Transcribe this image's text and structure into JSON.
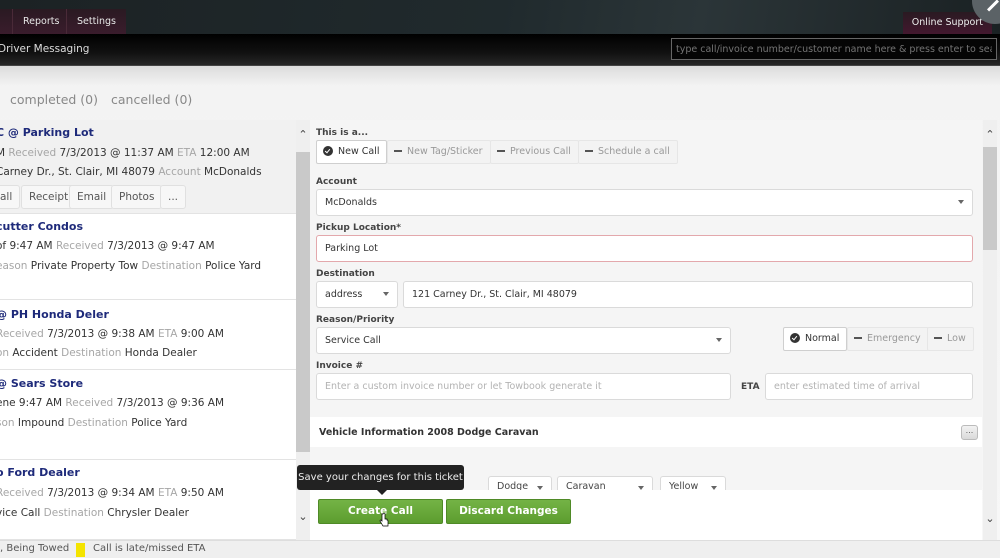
{
  "topnav": {
    "items": [
      "Reports",
      "Settings"
    ],
    "online_support": "Online Support"
  },
  "subbar": {
    "title": "Driver Messaging",
    "search_placeholder": "type call/invoice number/customer name here & press enter to search"
  },
  "status_tabs": [
    "completed (0)",
    "cancelled (0)"
  ],
  "calls": [
    {
      "title": "C @ Parking Lot",
      "line1": [
        {
          "t": "M",
          "l": false
        },
        {
          "t": "Received",
          "l": true
        },
        {
          "t": "7/3/2013 @ 11:37 AM",
          "l": false
        },
        {
          "t": "ETA",
          "l": true
        },
        {
          "t": "12:00 AM",
          "l": false
        }
      ],
      "line2": [
        {
          "t": "Carney Dr., St. Clair, MI 48079",
          "l": false
        },
        {
          "t": "Account",
          "l": true
        },
        {
          "t": "McDonalds",
          "l": false
        }
      ],
      "actions": [
        "all",
        "Receipt",
        "Email",
        "Photos",
        "..."
      ]
    },
    {
      "title": "cutter Condos",
      "line1": [
        {
          "t": "of 9:47 AM",
          "l": false
        },
        {
          "t": "Received",
          "l": true
        },
        {
          "t": "7/3/2013 @ 9:47 AM",
          "l": false
        }
      ],
      "line2": [
        {
          "t": "eason",
          "l": true
        },
        {
          "t": "Private Property Tow",
          "l": false
        },
        {
          "t": "Destination",
          "l": true
        },
        {
          "t": "Police Yard",
          "l": false
        }
      ]
    },
    {
      "title": "@ PH Honda Deler",
      "line1": [
        {
          "t": "Received",
          "l": true
        },
        {
          "t": "7/3/2013 @ 9:38 AM",
          "l": false
        },
        {
          "t": "ETA",
          "l": true
        },
        {
          "t": "9:00 AM",
          "l": false
        }
      ],
      "line2": [
        {
          "t": "on",
          "l": true
        },
        {
          "t": "Accident",
          "l": false
        },
        {
          "t": "Destination",
          "l": true
        },
        {
          "t": "Honda Dealer",
          "l": false
        }
      ]
    },
    {
      "title": "@ Sears Store",
      "line1": [
        {
          "t": "ene 9:47 AM",
          "l": false
        },
        {
          "t": "Received",
          "l": true
        },
        {
          "t": "7/3/2013 @ 9:36 AM",
          "l": false
        }
      ],
      "line2": [
        {
          "t": "son",
          "l": true
        },
        {
          "t": "Impound",
          "l": false
        },
        {
          "t": "Destination",
          "l": true
        },
        {
          "t": "Police Yard",
          "l": false
        }
      ]
    },
    {
      "title": "o Ford Dealer",
      "line1": [
        {
          "t": "Received",
          "l": true
        },
        {
          "t": "7/3/2013 @ 9:34 AM",
          "l": false
        },
        {
          "t": "ETA",
          "l": true
        },
        {
          "t": "9:50 AM",
          "l": false
        }
      ],
      "line2": [
        {
          "t": "vice Call",
          "l": false
        },
        {
          "t": "Destination",
          "l": true
        },
        {
          "t": "Chrysler Dealer",
          "l": false
        }
      ]
    }
  ],
  "form": {
    "call_type_label": "This is a...",
    "call_types": [
      "New Call",
      "New Tag/Sticker",
      "Previous Call",
      "Schedule a call"
    ],
    "selected_call_type": "New Call",
    "account_label": "Account",
    "account_value": "McDonalds",
    "pickup_label": "Pickup Location*",
    "pickup_value": "Parking Lot",
    "destination_label": "Destination",
    "destination_type": "address",
    "destination_value": "121 Carney Dr., St. Clair, MI 48079",
    "reason_label": "Reason/Priority",
    "reason_value": "Service Call",
    "priorities": [
      "Normal",
      "Emergency",
      "Low"
    ],
    "selected_priority": "Normal",
    "invoice_label": "Invoice #",
    "invoice_placeholder": "Enter a custom invoice number or let Towbook generate it",
    "eta_label": "ETA",
    "eta_placeholder": "enter estimated time of arrival",
    "vehicle_section_title": "Vehicle Information 2008 Dodge Caravan",
    "vehicle_more": "...",
    "vehicle_make": "Dodge",
    "vehicle_model": "Caravan",
    "vehicle_color": "Yellow"
  },
  "buttons": {
    "create_call": "Create Call",
    "discard_changes": "Discard Changes"
  },
  "tooltip": "Save your changes for this ticket",
  "legend": {
    "being_towed": ", Being Towed",
    "late": "Call is late/missed ETA",
    "late_color": "#f4e400"
  }
}
